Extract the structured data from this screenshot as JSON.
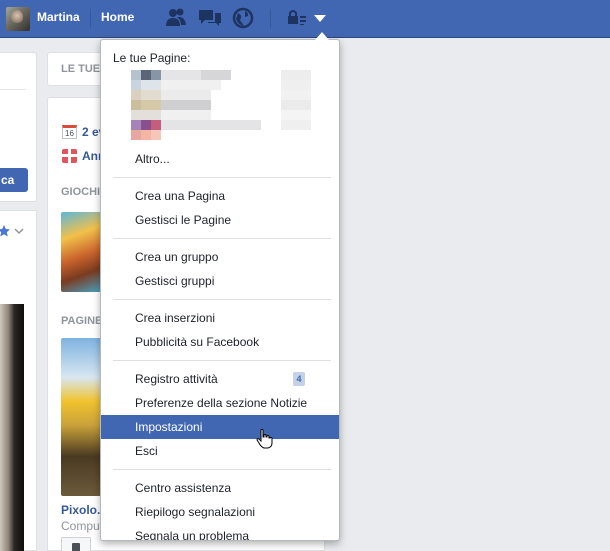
{
  "topbar": {
    "user_name": "Martina",
    "home_label": "Home",
    "icons": [
      "friends-icon",
      "messages-icon",
      "notifications-globe-icon",
      "privacy-lock-icon",
      "account-menu-caret-icon"
    ],
    "color": "#4267b2"
  },
  "left": {
    "button_label": "ca"
  },
  "right": {
    "top_label": "LE TUE",
    "events": [
      {
        "date": "16",
        "text": "2 ev"
      },
      {
        "text": "Ann"
      }
    ],
    "games_header": "GIOCHI",
    "pages_header": "PAGINE",
    "page_name": "Pixolo.",
    "page_category": "Comput"
  },
  "dropdown": {
    "pages_heading": "Le tue Pagine:",
    "more_label": "Altro...",
    "groups": [
      [
        "Crea una Pagina",
        "Gestisci le Pagine"
      ],
      [
        "Crea un gruppo",
        "Gestisci gruppi"
      ],
      [
        "Crea inserzioni",
        "Pubblicità su Facebook"
      ],
      [
        "Registro attività",
        "Preferenze della sezione Notizie",
        "Impostazioni",
        "Esci"
      ],
      [
        "Centro assistenza",
        "Riepilogo segnalazioni",
        "Segnala un problema"
      ]
    ],
    "activity_badge": "4",
    "highlighted_item": "Impostazioni",
    "highlight_color": "#4267b2"
  }
}
